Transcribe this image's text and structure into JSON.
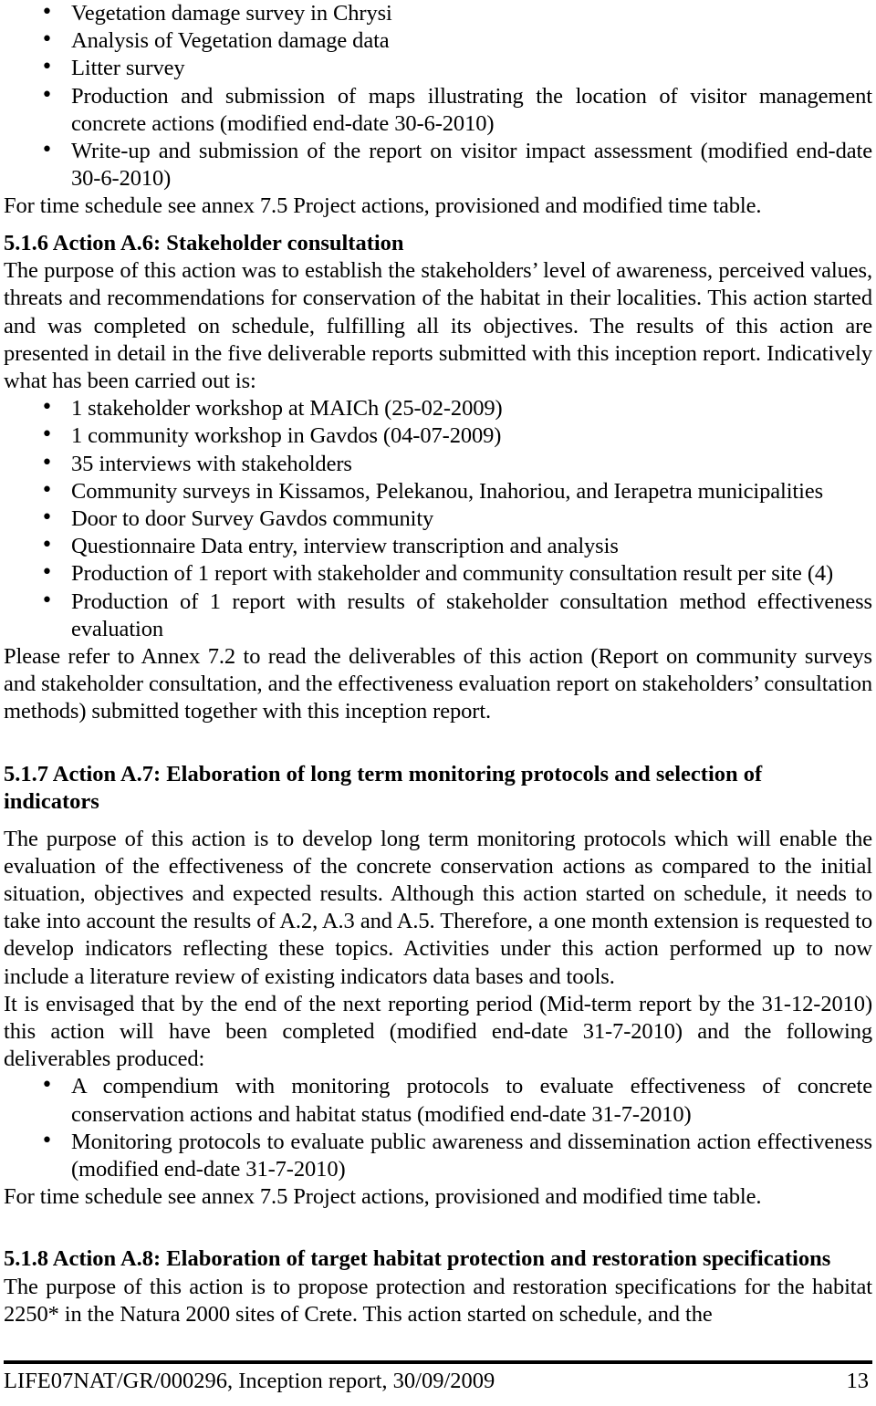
{
  "document": {
    "page_number": "13",
    "footer_text": "LIFE07NAT/GR/000296, Inception report, 30/09/2009"
  },
  "top_list": {
    "items": [
      "Vegetation damage survey in Chrysi",
      "Analysis of Vegetation damage data",
      "Litter survey",
      "Production and submission of maps illustrating the location of visitor management concrete actions (modified end-date 30-6-2010)",
      "Write-up and submission of the report on visitor impact assessment (modified end-date 30-6-2010)"
    ]
  },
  "top_note": "For time schedule see annex 7.5 Project actions, provisioned and modified time table.",
  "section_a6": {
    "heading": "5.1.6 Action A.6: Stakeholder consultation",
    "intro": "The purpose of this action was to establish the stakeholders’ level of awareness, perceived values, threats and recommendations for conservation of the habitat in their localities. This action started and was completed on schedule, fulfilling all its objectives. The results of this action are presented in detail in the five deliverable reports submitted with this inception report. Indicatively what has been carried out is:",
    "items": [
      "1 stakeholder workshop at MAICh (25-02-2009)",
      "1 community workshop in Gavdos (04-07-2009)",
      "35 interviews with stakeholders",
      "Community surveys in Kissamos, Pelekanou, Inahoriou, and Ierapetra municipalities",
      "Door to door Survey Gavdos community",
      "Questionnaire Data entry, interview transcription and analysis",
      "Production of 1 report with stakeholder and community consultation result per site (4)",
      "Production of 1 report with results of stakeholder consultation method effectiveness evaluation"
    ],
    "closing": "Please refer to Annex 7.2 to read the deliverables of this action (Report on community surveys and stakeholder consultation, and the effectiveness evaluation report on stakeholders’ consultation methods) submitted together with this inception report."
  },
  "section_a7": {
    "heading_line1": "5.1.7 Action A.7: Elaboration of long term monitoring protocols and selection of",
    "heading_line2": "indicators",
    "para1": "The purpose of this action is to develop long term monitoring protocols which will enable the evaluation of the effectiveness of the concrete conservation actions as compared to the initial situation, objectives and expected results. Although this action started on schedule, it needs to take into account the results of A.2, A.3 and A.5. Therefore, a one month extension is requested to develop indicators reflecting these topics. Activities under this action performed up to now include a literature review of existing indicators data bases and tools.",
    "para2": "It is envisaged that by the end of the next reporting period (Mid-term report by the 31-12-2010) this action will have been completed (modified end-date 31-7-2010) and the following deliverables produced:",
    "items": [
      "A compendium with monitoring protocols to evaluate effectiveness of concrete conservation actions and habitat status (modified end-date 31-7-2010)",
      "Monitoring protocols to evaluate public awareness and dissemination action effectiveness (modified end-date 31-7-2010)"
    ],
    "closing": "For time schedule see annex 7.5 Project actions, provisioned and modified time table."
  },
  "section_a8": {
    "heading": "5.1.8 Action A.8: Elaboration of target habitat protection and restoration specifications",
    "para1": "The purpose of this action is to propose protection and restoration specifications for the habitat 2250* in the Natura 2000 sites of Crete. This action started on schedule, and the"
  }
}
